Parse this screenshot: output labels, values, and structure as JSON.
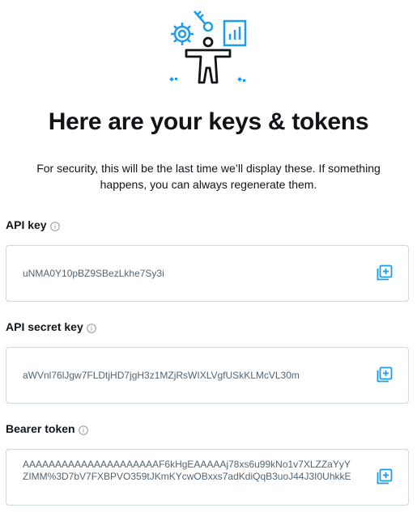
{
  "header": {
    "title": "Here are your keys & tokens",
    "subtitle": "For security, this will be the last time we’ll display these. If something happens, you can always regenerate them."
  },
  "fields": [
    {
      "label": "API key",
      "value": "uNMA0Y10pBZ9SBezLkhe7Sy3i"
    },
    {
      "label": "API secret key",
      "value": "aWVnl76lJgw7FLDtjHD7jgH3z1MZjRsWIXLVgfUSkKLMcVL30m"
    },
    {
      "label": "Bearer token",
      "value": "AAAAAAAAAAAAAAAAAAAAAF6kHgEAAAAAj78xs6u99kNo1v7XLZZaYyYZIMM%3D7bV7FXBPVO359tJKmKYcwOBxxs7adKdiQqB3uoJ44J3I0UhkkE"
    }
  ],
  "icons": {
    "info": "info-circle-icon",
    "copy": "copy-icon",
    "illustration": "developer-keys-illustration"
  },
  "colors": {
    "accent": "#1d9bf0",
    "text": "#0f1419",
    "muted": "#536471",
    "border": "#cfd9de"
  }
}
